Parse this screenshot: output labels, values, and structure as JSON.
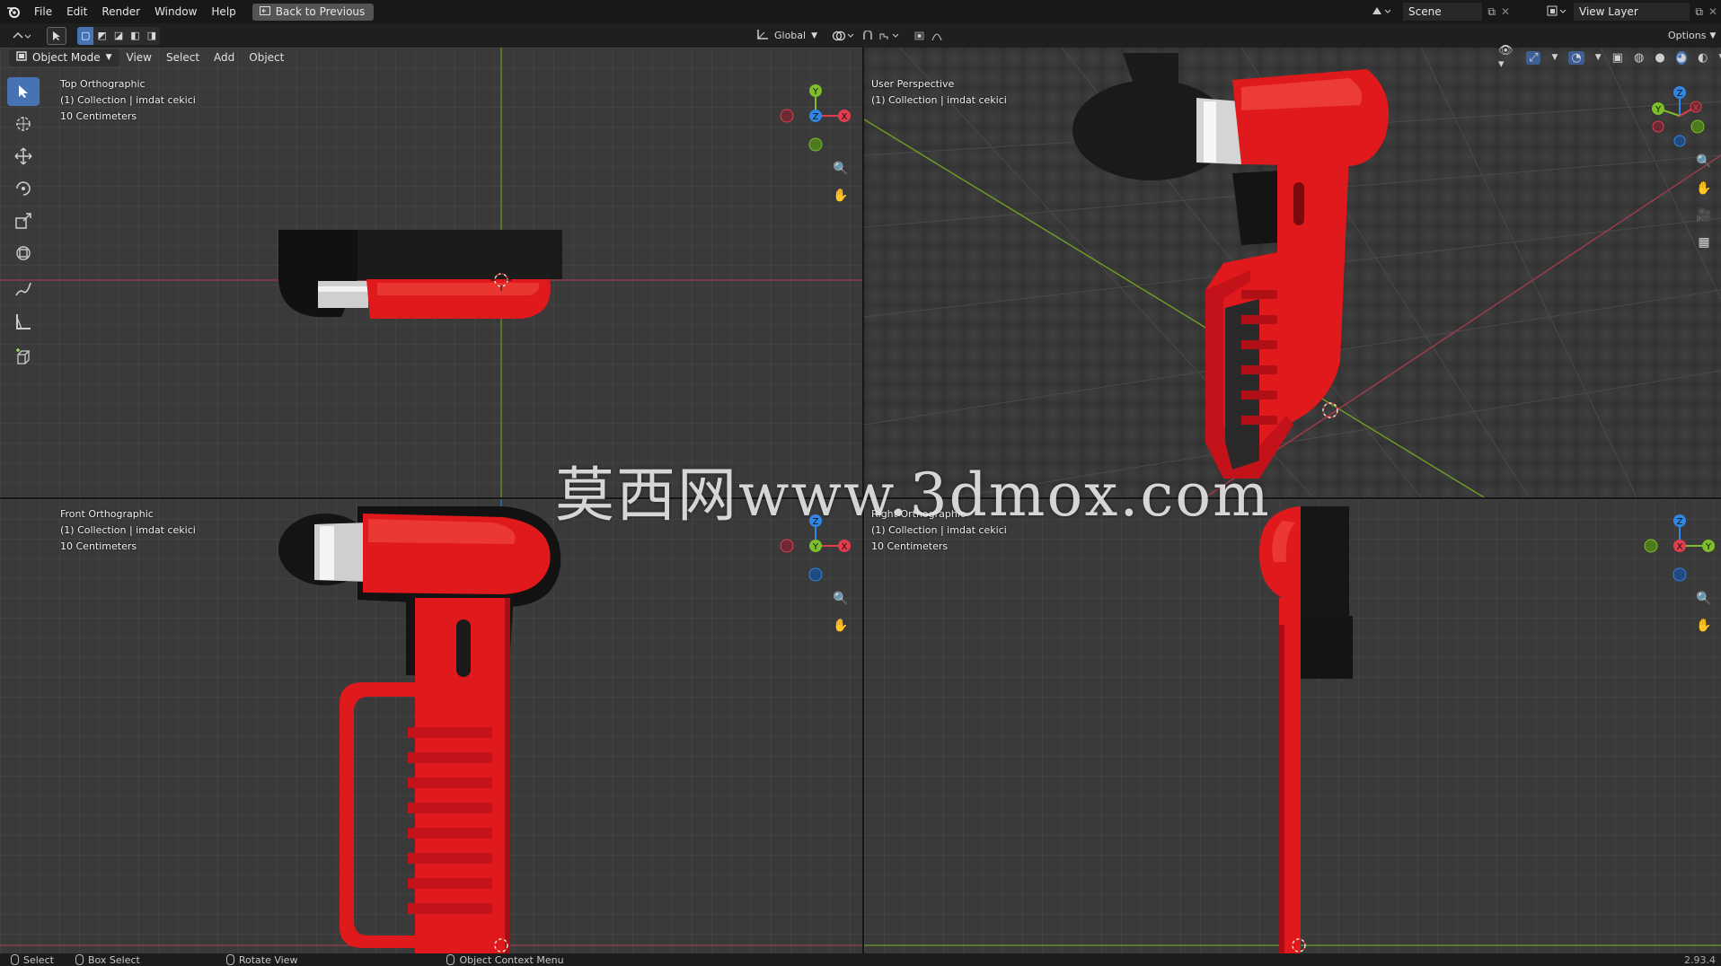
{
  "menu": {
    "file": "File",
    "edit": "Edit",
    "render": "Render",
    "window": "Window",
    "help": "Help"
  },
  "back_button": "Back to Previous",
  "scene": {
    "label": "Scene"
  },
  "view_layer": {
    "label": "View Layer"
  },
  "toolbar": {
    "orientation": "Global",
    "options": "Options"
  },
  "header": {
    "mode": "Object Mode",
    "view": "View",
    "select": "Select",
    "add": "Add",
    "object": "Object"
  },
  "viewports": {
    "top": {
      "view": "Top Orthographic",
      "collection": "(1) Collection | imdat cekici",
      "scale": "10 Centimeters"
    },
    "persp": {
      "view": "User Perspective",
      "collection": "(1) Collection | imdat cekici"
    },
    "front": {
      "view": "Front Orthographic",
      "collection": "(1) Collection | imdat cekici",
      "scale": "10 Centimeters"
    },
    "right": {
      "view": "Right Orthographic",
      "collection": "(1) Collection | imdat cekici",
      "scale": "10 Centimeters"
    }
  },
  "watermark": "莫西网www.3dmox.com",
  "status": {
    "select": "Select",
    "box_select": "Box Select",
    "rotate_view": "Rotate View",
    "context_menu": "Object Context Menu",
    "version": "2.93.4"
  },
  "colors": {
    "accent": "#4772b3",
    "object_red": "#e0191c",
    "x_axis": "#e23d4c",
    "y_axis": "#7cbf2a",
    "z_axis": "#2f86e6"
  }
}
